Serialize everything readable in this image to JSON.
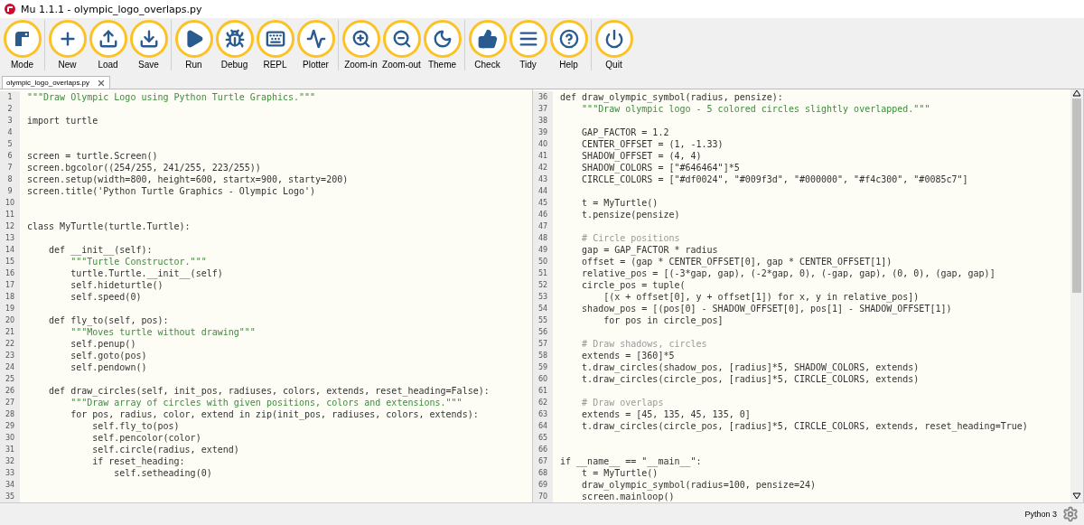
{
  "window": {
    "title": "Mu 1.1.1 - olympic_logo_overlaps.py"
  },
  "toolbar": [
    [
      {
        "kind": "mode",
        "label": "Mode"
      }
    ],
    [
      {
        "kind": "new",
        "label": "New"
      },
      {
        "kind": "load",
        "label": "Load"
      },
      {
        "kind": "save",
        "label": "Save"
      }
    ],
    [
      {
        "kind": "run",
        "label": "Run"
      },
      {
        "kind": "debug",
        "label": "Debug"
      },
      {
        "kind": "repl",
        "label": "REPL"
      },
      {
        "kind": "plotter",
        "label": "Plotter"
      }
    ],
    [
      {
        "kind": "zoomin",
        "label": "Zoom-in"
      },
      {
        "kind": "zoomout",
        "label": "Zoom-out"
      },
      {
        "kind": "theme",
        "label": "Theme"
      }
    ],
    [
      {
        "kind": "check",
        "label": "Check"
      },
      {
        "kind": "tidy",
        "label": "Tidy"
      },
      {
        "kind": "help",
        "label": "Help"
      }
    ],
    [
      {
        "kind": "quit",
        "label": "Quit"
      }
    ]
  ],
  "tabs": [
    {
      "label": "olympic_logo_overlaps.py",
      "selected": true
    }
  ],
  "panes": [
    {
      "lines": [
        {
          "number": "1",
          "kind": "docstring",
          "text": "\"\"\"Draw Olympic Logo using Python Turtle Graphics.\"\"\""
        },
        {
          "number": "2"
        },
        {
          "number": "3",
          "kind": "code",
          "text": "import turtle"
        },
        {
          "number": "4"
        },
        {
          "number": "5"
        },
        {
          "number": "6",
          "kind": "code",
          "text": "screen = turtle.Screen()"
        },
        {
          "number": "7",
          "kind": "code",
          "text": "screen.bgcolor((254/255, 241/255, 223/255))"
        },
        {
          "number": "8",
          "kind": "code",
          "text": "screen.setup(width=800, height=600, startx=900, starty=200)"
        },
        {
          "number": "9",
          "kind": "code",
          "text": "screen.title('Python Turtle Graphics - Olympic Logo')"
        },
        {
          "number": "10"
        },
        {
          "number": "11"
        },
        {
          "number": "12",
          "kind": "code",
          "text": "class MyTurtle(turtle.Turtle):"
        },
        {
          "number": "13"
        },
        {
          "number": "14",
          "kind": "code",
          "text": "    def __init__(self):"
        },
        {
          "number": "15",
          "kind": "docstring",
          "text": "        \"\"\"Turtle Constructor.\"\"\""
        },
        {
          "number": "16",
          "kind": "code",
          "text": "        turtle.Turtle.__init__(self)"
        },
        {
          "number": "17",
          "kind": "code",
          "text": "        self.hideturtle()"
        },
        {
          "number": "18",
          "kind": "code",
          "text": "        self.speed(0)"
        },
        {
          "number": "19"
        },
        {
          "number": "20",
          "kind": "code",
          "text": "    def fly_to(self, pos):"
        },
        {
          "number": "21",
          "kind": "docstring",
          "text": "        \"\"\"Moves turtle without drawing\"\"\""
        },
        {
          "number": "22",
          "kind": "code",
          "text": "        self.penup()"
        },
        {
          "number": "23",
          "kind": "code",
          "text": "        self.goto(pos)"
        },
        {
          "number": "24",
          "kind": "code",
          "text": "        self.pendown()"
        },
        {
          "number": "25"
        },
        {
          "number": "26",
          "kind": "code",
          "text": "    def draw_circles(self, init_pos, radiuses, colors, extends, reset_heading=False):"
        },
        {
          "number": "27",
          "kind": "docstring",
          "text": "        \"\"\"Draw array of circles with given positions, colors and extensions.\"\"\""
        },
        {
          "number": "28",
          "kind": "code",
          "text": "        for pos, radius, color, extend in zip(init_pos, radiuses, colors, extends):"
        },
        {
          "number": "29",
          "kind": "code",
          "text": "            self.fly_to(pos)"
        },
        {
          "number": "30",
          "kind": "code",
          "text": "            self.pencolor(color)"
        },
        {
          "number": "31",
          "kind": "code",
          "text": "            self.circle(radius, extend)"
        },
        {
          "number": "32",
          "kind": "code",
          "text": "            if reset_heading:"
        },
        {
          "number": "33",
          "kind": "code",
          "text": "                self.setheading(0)"
        },
        {
          "number": "34"
        },
        {
          "number": "35"
        }
      ]
    },
    {
      "lines": [
        {
          "number": "36",
          "kind": "code",
          "text": "def draw_olympic_symbol(radius, pensize):"
        },
        {
          "number": "37",
          "kind": "docstring",
          "text": "    \"\"\"Draw olympic logo - 5 colored circles slightly overlapped.\"\"\""
        },
        {
          "number": "38"
        },
        {
          "number": "39",
          "kind": "code",
          "text": "    GAP_FACTOR = 1.2"
        },
        {
          "number": "40",
          "kind": "code",
          "text": "    CENTER_OFFSET = (1, -1.33)"
        },
        {
          "number": "41",
          "kind": "code",
          "text": "    SHADOW_OFFSET = (4, 4)"
        },
        {
          "number": "42",
          "kind": "code",
          "text": "    SHADOW_COLORS = [\"#646464\"]*5"
        },
        {
          "number": "43",
          "kind": "code",
          "text": "    CIRCLE_COLORS = [\"#df0024\", \"#009f3d\", \"#000000\", \"#f4c300\", \"#0085c7\"]"
        },
        {
          "number": "44"
        },
        {
          "number": "45",
          "kind": "code",
          "text": "    t = MyTurtle()"
        },
        {
          "number": "46",
          "kind": "code",
          "text": "    t.pensize(pensize)"
        },
        {
          "number": "47"
        },
        {
          "number": "48",
          "kind": "comment",
          "text": "    # Circle positions"
        },
        {
          "number": "49",
          "kind": "code",
          "text": "    gap = GAP_FACTOR * radius"
        },
        {
          "number": "50",
          "kind": "code",
          "text": "    offset = (gap * CENTER_OFFSET[0], gap * CENTER_OFFSET[1])"
        },
        {
          "number": "51",
          "kind": "code",
          "text": "    relative_pos = [(-3*gap, gap), (-2*gap, 0), (-gap, gap), (0, 0), (gap, gap)]"
        },
        {
          "number": "52",
          "kind": "code",
          "text": "    circle_pos = tuple("
        },
        {
          "number": "53",
          "kind": "code",
          "text": "        [(x + offset[0], y + offset[1]) for x, y in relative_pos])"
        },
        {
          "number": "54",
          "kind": "code",
          "text": "    shadow_pos = [(pos[0] - SHADOW_OFFSET[0], pos[1] - SHADOW_OFFSET[1])"
        },
        {
          "number": "55",
          "kind": "code",
          "text": "        for pos in circle_pos]"
        },
        {
          "number": "56"
        },
        {
          "number": "57",
          "kind": "comment",
          "text": "    # Draw shadows, circles"
        },
        {
          "number": "58",
          "kind": "code",
          "text": "    extends = [360]*5"
        },
        {
          "number": "59",
          "kind": "code",
          "text": "    t.draw_circles(shadow_pos, [radius]*5, SHADOW_COLORS, extends)"
        },
        {
          "number": "60",
          "kind": "code",
          "text": "    t.draw_circles(circle_pos, [radius]*5, CIRCLE_COLORS, extends)"
        },
        {
          "number": "61"
        },
        {
          "number": "62",
          "kind": "comment",
          "text": "    # Draw overlaps"
        },
        {
          "number": "63",
          "kind": "code",
          "text": "    extends = [45, 135, 45, 135, 0]"
        },
        {
          "number": "64",
          "kind": "code",
          "text": "    t.draw_circles(circle_pos, [radius]*5, CIRCLE_COLORS, extends, reset_heading=True)"
        },
        {
          "number": "65"
        },
        {
          "number": "66"
        },
        {
          "number": "67",
          "kind": "code",
          "text": "if __name__ == \"__main__\":"
        },
        {
          "number": "68",
          "kind": "code",
          "text": "    t = MyTurtle()"
        },
        {
          "number": "69",
          "kind": "code",
          "text": "    draw_olympic_symbol(radius=100, pensize=24)"
        },
        {
          "number": "70",
          "kind": "code",
          "text": "    screen.mainloop()"
        }
      ]
    }
  ],
  "status_bar": {
    "mode": "Python 3"
  }
}
